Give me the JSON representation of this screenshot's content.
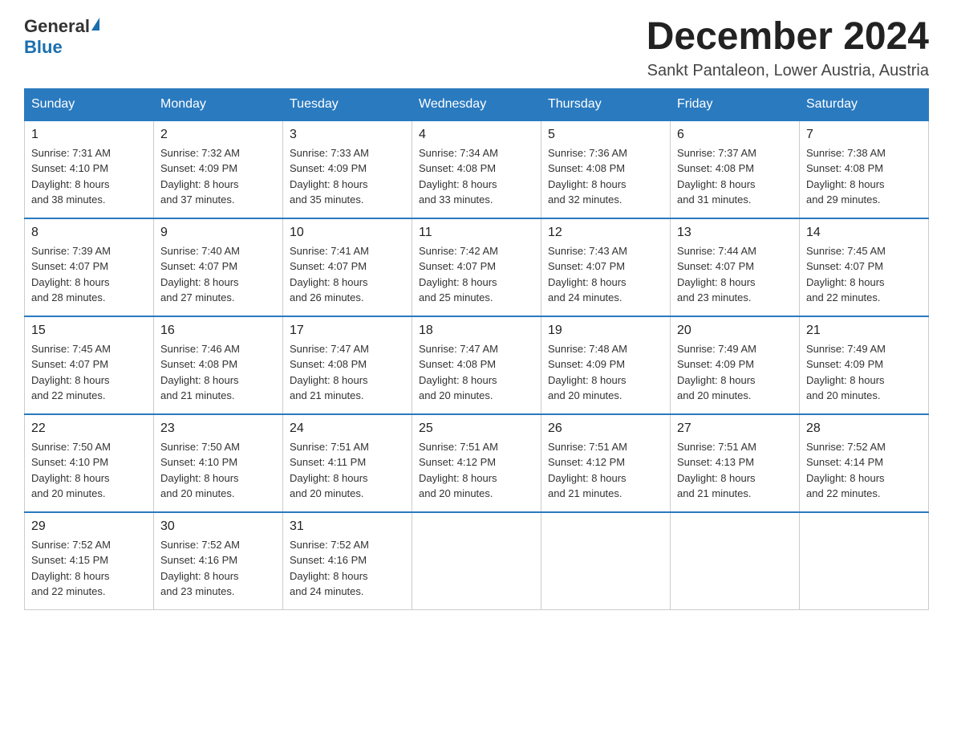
{
  "logo": {
    "general": "General",
    "blue": "Blue"
  },
  "title": "December 2024",
  "location": "Sankt Pantaleon, Lower Austria, Austria",
  "weekdays": [
    "Sunday",
    "Monday",
    "Tuesday",
    "Wednesday",
    "Thursday",
    "Friday",
    "Saturday"
  ],
  "weeks": [
    [
      {
        "day": "1",
        "sunrise": "7:31 AM",
        "sunset": "4:10 PM",
        "daylight": "8 hours and 38 minutes."
      },
      {
        "day": "2",
        "sunrise": "7:32 AM",
        "sunset": "4:09 PM",
        "daylight": "8 hours and 37 minutes."
      },
      {
        "day": "3",
        "sunrise": "7:33 AM",
        "sunset": "4:09 PM",
        "daylight": "8 hours and 35 minutes."
      },
      {
        "day": "4",
        "sunrise": "7:34 AM",
        "sunset": "4:08 PM",
        "daylight": "8 hours and 33 minutes."
      },
      {
        "day": "5",
        "sunrise": "7:36 AM",
        "sunset": "4:08 PM",
        "daylight": "8 hours and 32 minutes."
      },
      {
        "day": "6",
        "sunrise": "7:37 AM",
        "sunset": "4:08 PM",
        "daylight": "8 hours and 31 minutes."
      },
      {
        "day": "7",
        "sunrise": "7:38 AM",
        "sunset": "4:08 PM",
        "daylight": "8 hours and 29 minutes."
      }
    ],
    [
      {
        "day": "8",
        "sunrise": "7:39 AM",
        "sunset": "4:07 PM",
        "daylight": "8 hours and 28 minutes."
      },
      {
        "day": "9",
        "sunrise": "7:40 AM",
        "sunset": "4:07 PM",
        "daylight": "8 hours and 27 minutes."
      },
      {
        "day": "10",
        "sunrise": "7:41 AM",
        "sunset": "4:07 PM",
        "daylight": "8 hours and 26 minutes."
      },
      {
        "day": "11",
        "sunrise": "7:42 AM",
        "sunset": "4:07 PM",
        "daylight": "8 hours and 25 minutes."
      },
      {
        "day": "12",
        "sunrise": "7:43 AM",
        "sunset": "4:07 PM",
        "daylight": "8 hours and 24 minutes."
      },
      {
        "day": "13",
        "sunrise": "7:44 AM",
        "sunset": "4:07 PM",
        "daylight": "8 hours and 23 minutes."
      },
      {
        "day": "14",
        "sunrise": "7:45 AM",
        "sunset": "4:07 PM",
        "daylight": "8 hours and 22 minutes."
      }
    ],
    [
      {
        "day": "15",
        "sunrise": "7:45 AM",
        "sunset": "4:07 PM",
        "daylight": "8 hours and 22 minutes."
      },
      {
        "day": "16",
        "sunrise": "7:46 AM",
        "sunset": "4:08 PM",
        "daylight": "8 hours and 21 minutes."
      },
      {
        "day": "17",
        "sunrise": "7:47 AM",
        "sunset": "4:08 PM",
        "daylight": "8 hours and 21 minutes."
      },
      {
        "day": "18",
        "sunrise": "7:47 AM",
        "sunset": "4:08 PM",
        "daylight": "8 hours and 20 minutes."
      },
      {
        "day": "19",
        "sunrise": "7:48 AM",
        "sunset": "4:09 PM",
        "daylight": "8 hours and 20 minutes."
      },
      {
        "day": "20",
        "sunrise": "7:49 AM",
        "sunset": "4:09 PM",
        "daylight": "8 hours and 20 minutes."
      },
      {
        "day": "21",
        "sunrise": "7:49 AM",
        "sunset": "4:09 PM",
        "daylight": "8 hours and 20 minutes."
      }
    ],
    [
      {
        "day": "22",
        "sunrise": "7:50 AM",
        "sunset": "4:10 PM",
        "daylight": "8 hours and 20 minutes."
      },
      {
        "day": "23",
        "sunrise": "7:50 AM",
        "sunset": "4:10 PM",
        "daylight": "8 hours and 20 minutes."
      },
      {
        "day": "24",
        "sunrise": "7:51 AM",
        "sunset": "4:11 PM",
        "daylight": "8 hours and 20 minutes."
      },
      {
        "day": "25",
        "sunrise": "7:51 AM",
        "sunset": "4:12 PM",
        "daylight": "8 hours and 20 minutes."
      },
      {
        "day": "26",
        "sunrise": "7:51 AM",
        "sunset": "4:12 PM",
        "daylight": "8 hours and 21 minutes."
      },
      {
        "day": "27",
        "sunrise": "7:51 AM",
        "sunset": "4:13 PM",
        "daylight": "8 hours and 21 minutes."
      },
      {
        "day": "28",
        "sunrise": "7:52 AM",
        "sunset": "4:14 PM",
        "daylight": "8 hours and 22 minutes."
      }
    ],
    [
      {
        "day": "29",
        "sunrise": "7:52 AM",
        "sunset": "4:15 PM",
        "daylight": "8 hours and 22 minutes."
      },
      {
        "day": "30",
        "sunrise": "7:52 AM",
        "sunset": "4:16 PM",
        "daylight": "8 hours and 23 minutes."
      },
      {
        "day": "31",
        "sunrise": "7:52 AM",
        "sunset": "4:16 PM",
        "daylight": "8 hours and 24 minutes."
      },
      null,
      null,
      null,
      null
    ]
  ],
  "labels": {
    "sunrise": "Sunrise:",
    "sunset": "Sunset:",
    "daylight": "Daylight:"
  }
}
